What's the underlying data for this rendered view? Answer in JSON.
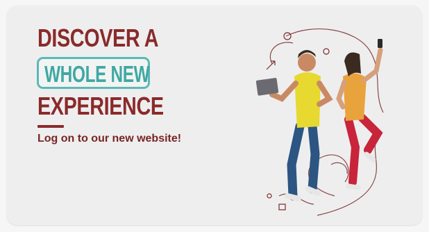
{
  "banner": {
    "headline_line1": "DISCOVER A",
    "headline_highlight": "WHOLE NEW",
    "headline_line3": "EXPERIENCE",
    "tagline": "Log on to our new website!"
  },
  "colors": {
    "headline": "#8a2a2a",
    "highlight_border": "#5cb9b5",
    "highlight_text": "#3fa8a3",
    "card_background": "#eeeeef"
  },
  "icons": [
    "laptop-icon",
    "smartphone-icon",
    "gift-icon",
    "percent-icon",
    "arrow-icon"
  ]
}
